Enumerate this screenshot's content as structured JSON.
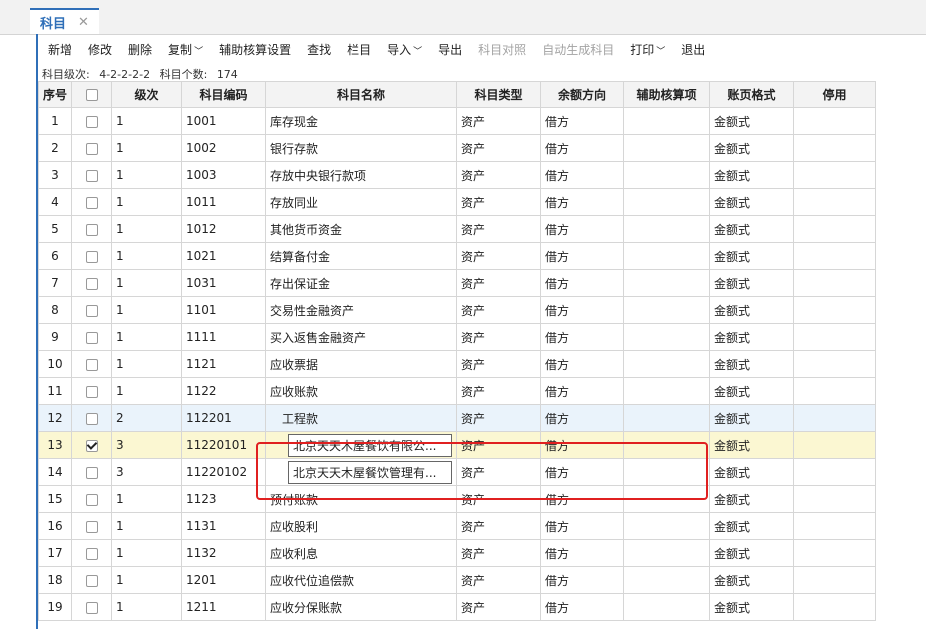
{
  "tab": {
    "label": "科目",
    "close": "✕"
  },
  "toolbar": [
    {
      "label": "新增",
      "disabled": false,
      "dropdown": false
    },
    {
      "label": "修改",
      "disabled": false,
      "dropdown": false
    },
    {
      "label": "删除",
      "disabled": false,
      "dropdown": false
    },
    {
      "label": "复制",
      "disabled": false,
      "dropdown": true
    },
    {
      "label": "辅助核算设置",
      "disabled": false,
      "dropdown": false
    },
    {
      "label": "查找",
      "disabled": false,
      "dropdown": false
    },
    {
      "label": "栏目",
      "disabled": false,
      "dropdown": false
    },
    {
      "label": "导入",
      "disabled": false,
      "dropdown": true
    },
    {
      "label": "导出",
      "disabled": false,
      "dropdown": false
    },
    {
      "label": "科目对照",
      "disabled": true,
      "dropdown": false
    },
    {
      "label": "自动生成科目",
      "disabled": true,
      "dropdown": false
    },
    {
      "label": "打印",
      "disabled": false,
      "dropdown": true
    },
    {
      "label": "退出",
      "disabled": false,
      "dropdown": false
    }
  ],
  "info": {
    "levels_label": "科目级次:",
    "levels_value": "4-2-2-2-2",
    "count_label": "科目个数:",
    "count_value": "174"
  },
  "columns": [
    "序号",
    "",
    "级次",
    "科目编码",
    "科目名称",
    "科目类型",
    "余额方向",
    "辅助核算项",
    "账页格式",
    "停用"
  ],
  "rows": [
    {
      "idx": "1",
      "checked": false,
      "level": "1",
      "code": "1001",
      "name": "库存现金",
      "type": "资产",
      "dir": "借方",
      "aux": "",
      "format": "金额式",
      "stop": ""
    },
    {
      "idx": "2",
      "checked": false,
      "level": "1",
      "code": "1002",
      "name": "银行存款",
      "type": "资产",
      "dir": "借方",
      "aux": "",
      "format": "金额式",
      "stop": ""
    },
    {
      "idx": "3",
      "checked": false,
      "level": "1",
      "code": "1003",
      "name": "存放中央银行款项",
      "type": "资产",
      "dir": "借方",
      "aux": "",
      "format": "金额式",
      "stop": ""
    },
    {
      "idx": "4",
      "checked": false,
      "level": "1",
      "code": "1011",
      "name": "存放同业",
      "type": "资产",
      "dir": "借方",
      "aux": "",
      "format": "金额式",
      "stop": ""
    },
    {
      "idx": "5",
      "checked": false,
      "level": "1",
      "code": "1012",
      "name": "其他货币资金",
      "type": "资产",
      "dir": "借方",
      "aux": "",
      "format": "金额式",
      "stop": ""
    },
    {
      "idx": "6",
      "checked": false,
      "level": "1",
      "code": "1021",
      "name": "结算备付金",
      "type": "资产",
      "dir": "借方",
      "aux": "",
      "format": "金额式",
      "stop": ""
    },
    {
      "idx": "7",
      "checked": false,
      "level": "1",
      "code": "1031",
      "name": "存出保证金",
      "type": "资产",
      "dir": "借方",
      "aux": "",
      "format": "金额式",
      "stop": ""
    },
    {
      "idx": "8",
      "checked": false,
      "level": "1",
      "code": "1101",
      "name": "交易性金融资产",
      "type": "资产",
      "dir": "借方",
      "aux": "",
      "format": "金额式",
      "stop": ""
    },
    {
      "idx": "9",
      "checked": false,
      "level": "1",
      "code": "1111",
      "name": "买入返售金融资产",
      "type": "资产",
      "dir": "借方",
      "aux": "",
      "format": "金额式",
      "stop": ""
    },
    {
      "idx": "10",
      "checked": false,
      "level": "1",
      "code": "1121",
      "name": "应收票据",
      "type": "资产",
      "dir": "借方",
      "aux": "",
      "format": "金额式",
      "stop": ""
    },
    {
      "idx": "11",
      "checked": false,
      "level": "1",
      "code": "1122",
      "name": "应收账款",
      "type": "资产",
      "dir": "借方",
      "aux": "",
      "format": "金额式",
      "stop": ""
    },
    {
      "idx": "12",
      "checked": false,
      "level": "2",
      "code": "112201",
      "name": "工程款",
      "type": "资产",
      "dir": "借方",
      "aux": "",
      "format": "金额式",
      "stop": "",
      "state": "hover"
    },
    {
      "idx": "13",
      "checked": true,
      "level": "3",
      "code": "11220101",
      "name": "北京天天木屋餐饮有限公...",
      "type": "资产",
      "dir": "借方",
      "aux": "",
      "format": "金额式",
      "stop": "",
      "state": "selected"
    },
    {
      "idx": "14",
      "checked": false,
      "level": "3",
      "code": "11220102",
      "name": "北京天天木屋餐饮管理有...",
      "type": "资产",
      "dir": "借方",
      "aux": "",
      "format": "金额式",
      "stop": ""
    },
    {
      "idx": "15",
      "checked": false,
      "level": "1",
      "code": "1123",
      "name": "预付账款",
      "type": "资产",
      "dir": "借方",
      "aux": "",
      "format": "金额式",
      "stop": ""
    },
    {
      "idx": "16",
      "checked": false,
      "level": "1",
      "code": "1131",
      "name": "应收股利",
      "type": "资产",
      "dir": "借方",
      "aux": "",
      "format": "金额式",
      "stop": ""
    },
    {
      "idx": "17",
      "checked": false,
      "level": "1",
      "code": "1132",
      "name": "应收利息",
      "type": "资产",
      "dir": "借方",
      "aux": "",
      "format": "金额式",
      "stop": ""
    },
    {
      "idx": "18",
      "checked": false,
      "level": "1",
      "code": "1201",
      "name": "应收代位追偿款",
      "type": "资产",
      "dir": "借方",
      "aux": "",
      "format": "金额式",
      "stop": ""
    },
    {
      "idx": "19",
      "checked": false,
      "level": "1",
      "code": "1211",
      "name": "应收分保账款",
      "type": "资产",
      "dir": "借方",
      "aux": "",
      "format": "金额式",
      "stop": ""
    }
  ],
  "colors": {
    "accent": "#2f6fb8",
    "highlight_box": "#e02020",
    "selected_row": "#fbf7d2",
    "hover_row": "#eaf3fb"
  }
}
